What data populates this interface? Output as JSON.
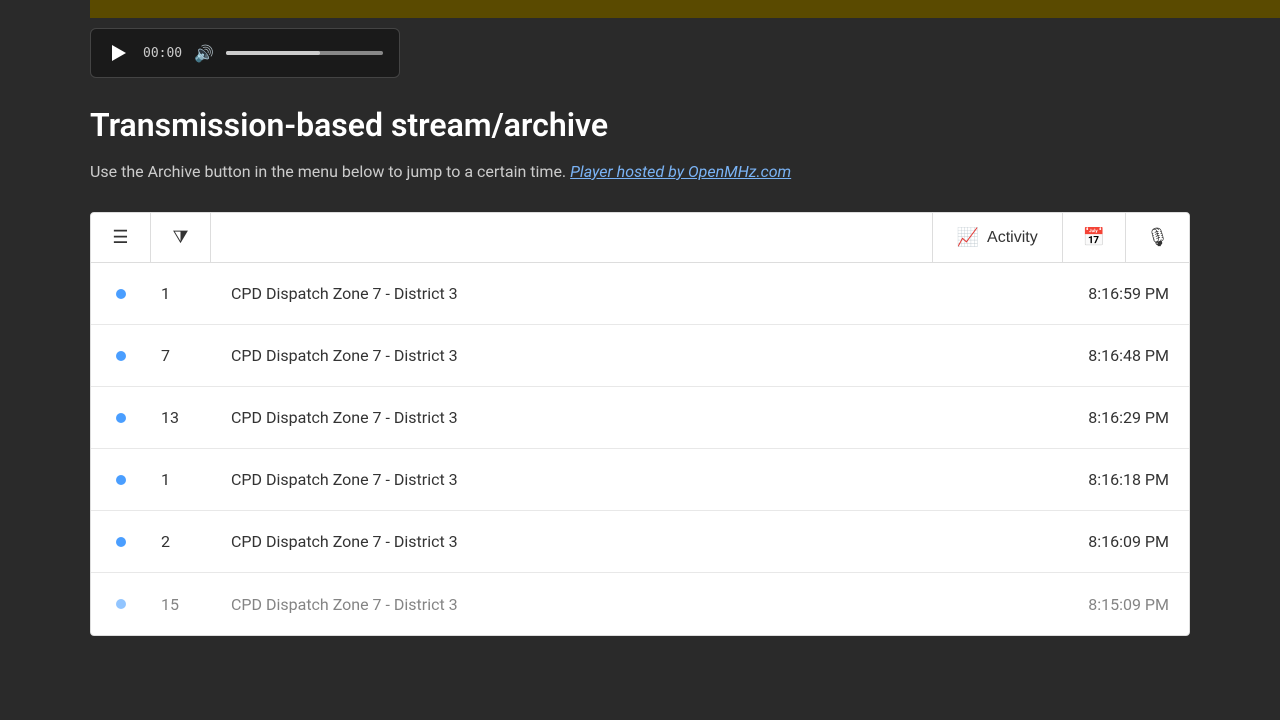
{
  "top_bar": {
    "color": "#5a4a00"
  },
  "audio_player": {
    "time": "00:00",
    "play_label": "Play"
  },
  "section": {
    "title": "Transmission-based stream/archive",
    "description": "Use the Archive button in the menu below to jump to a certain time.",
    "link_text": "Player hosted by OpenMHz.com",
    "link_url": "#"
  },
  "toolbar": {
    "menu_label": "Menu",
    "filter_label": "Filter",
    "activity_label": "Activity",
    "calendar_label": "Calendar",
    "mic_label": "Microphone"
  },
  "table": {
    "rows": [
      {
        "dot": true,
        "number": "1",
        "name": "CPD Dispatch Zone 7 - District 3",
        "time": "8:16:59 PM"
      },
      {
        "dot": true,
        "number": "7",
        "name": "CPD Dispatch Zone 7 - District 3",
        "time": "8:16:48 PM"
      },
      {
        "dot": true,
        "number": "13",
        "name": "CPD Dispatch Zone 7 - District 3",
        "time": "8:16:29 PM"
      },
      {
        "dot": true,
        "number": "1",
        "name": "CPD Dispatch Zone 7 - District 3",
        "time": "8:16:18 PM"
      },
      {
        "dot": true,
        "number": "2",
        "name": "CPD Dispatch Zone 7 - District 3",
        "time": "8:16:09 PM"
      },
      {
        "dot": true,
        "number": "15",
        "name": "CPD Dispatch Zone 7 - District 3",
        "time": "8:15:09 PM"
      }
    ]
  }
}
